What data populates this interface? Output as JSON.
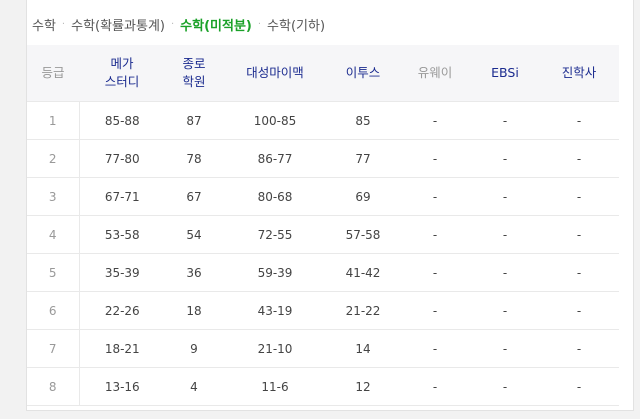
{
  "subtabs": [
    "수학",
    "수학(확률과통계)",
    "수학(미적분)",
    "수학(기하)"
  ],
  "active_subtab_index": 2,
  "colors": {
    "accent_green": "#1aa128",
    "header_navy": "#1b2b8f",
    "header_gray": "#999999"
  },
  "table": {
    "headers": {
      "grade": "등급",
      "megastudy": "메가\n스터디",
      "jongro": "종로\n학원",
      "daesung": "대성마이맥",
      "etoos": "이투스",
      "uway": "유웨이",
      "ebsi": "EBSi",
      "jinhak": "진학사"
    },
    "rows": [
      {
        "grade": "1",
        "megastudy": "85-88",
        "jongro": "87",
        "daesung": "100-85",
        "etoos": "85",
        "uway": "-",
        "ebsi": "-",
        "jinhak": "-"
      },
      {
        "grade": "2",
        "megastudy": "77-80",
        "jongro": "78",
        "daesung": "86-77",
        "etoos": "77",
        "uway": "-",
        "ebsi": "-",
        "jinhak": "-"
      },
      {
        "grade": "3",
        "megastudy": "67-71",
        "jongro": "67",
        "daesung": "80-68",
        "etoos": "69",
        "uway": "-",
        "ebsi": "-",
        "jinhak": "-"
      },
      {
        "grade": "4",
        "megastudy": "53-58",
        "jongro": "54",
        "daesung": "72-55",
        "etoos": "57-58",
        "uway": "-",
        "ebsi": "-",
        "jinhak": "-"
      },
      {
        "grade": "5",
        "megastudy": "35-39",
        "jongro": "36",
        "daesung": "59-39",
        "etoos": "41-42",
        "uway": "-",
        "ebsi": "-",
        "jinhak": "-"
      },
      {
        "grade": "6",
        "megastudy": "22-26",
        "jongro": "18",
        "daesung": "43-19",
        "etoos": "21-22",
        "uway": "-",
        "ebsi": "-",
        "jinhak": "-"
      },
      {
        "grade": "7",
        "megastudy": "18-21",
        "jongro": "9",
        "daesung": "21-10",
        "etoos": "14",
        "uway": "-",
        "ebsi": "-",
        "jinhak": "-"
      },
      {
        "grade": "8",
        "megastudy": "13-16",
        "jongro": "4",
        "daesung": "11-6",
        "etoos": "12",
        "uway": "-",
        "ebsi": "-",
        "jinhak": "-"
      }
    ]
  }
}
